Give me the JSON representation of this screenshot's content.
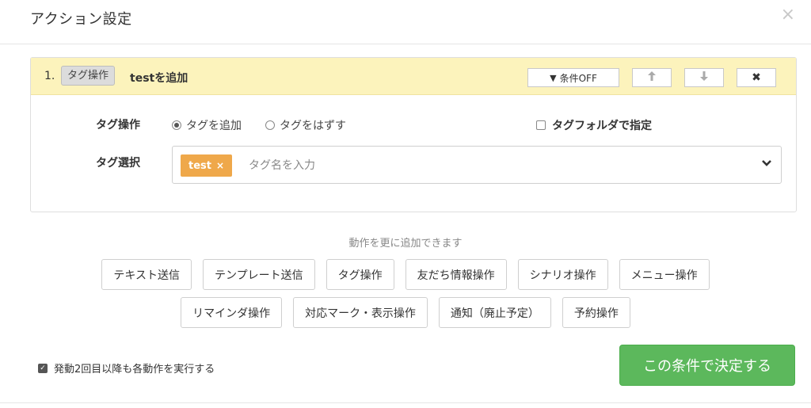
{
  "modal": {
    "title": "アクション設定",
    "close_glyph": "×"
  },
  "action": {
    "number": "1.",
    "type_label": "タグ操作",
    "summary": "testを追加",
    "cond_button": "条件OFF",
    "up_glyph": "🡑",
    "down_glyph": "🡓",
    "delete_glyph": "✖",
    "op_label": "タグ操作",
    "radio_add": "タグを追加",
    "radio_remove": "タグをはずす",
    "radio_selected": "タグを追加",
    "folder_checkbox": "タグフォルダで指定",
    "folder_checked": false,
    "select_label": "タグ選択",
    "selected_tag": "test",
    "tag_remove_glyph": "×",
    "tag_placeholder": "タグ名を入力",
    "chevron_glyph": "❯"
  },
  "add_actions": {
    "hint": "動作を更に追加できます",
    "row1": [
      "テキスト送信",
      "テンプレート送信",
      "タグ操作",
      "友だち情報操作",
      "シナリオ操作",
      "メニュー操作"
    ],
    "row2": [
      "リマインダ操作",
      "対応マーク・表示操作",
      "通知（廃止予定）",
      "予約操作"
    ]
  },
  "footer": {
    "repeat_label": "発動2回目以降も各動作を実行する",
    "repeat_checked": true,
    "submit_label": "この条件で決定する"
  },
  "colors": {
    "header_bg": "#fcf3bc",
    "tag_chip": "#efa84a",
    "submit": "#5cb85c"
  },
  "icons": {
    "funnel": "funnel-icon",
    "arrow_up": "arrow-up-icon",
    "arrow_down": "arrow-down-icon",
    "close": "close-icon",
    "chevron": "chevron-down-icon"
  }
}
